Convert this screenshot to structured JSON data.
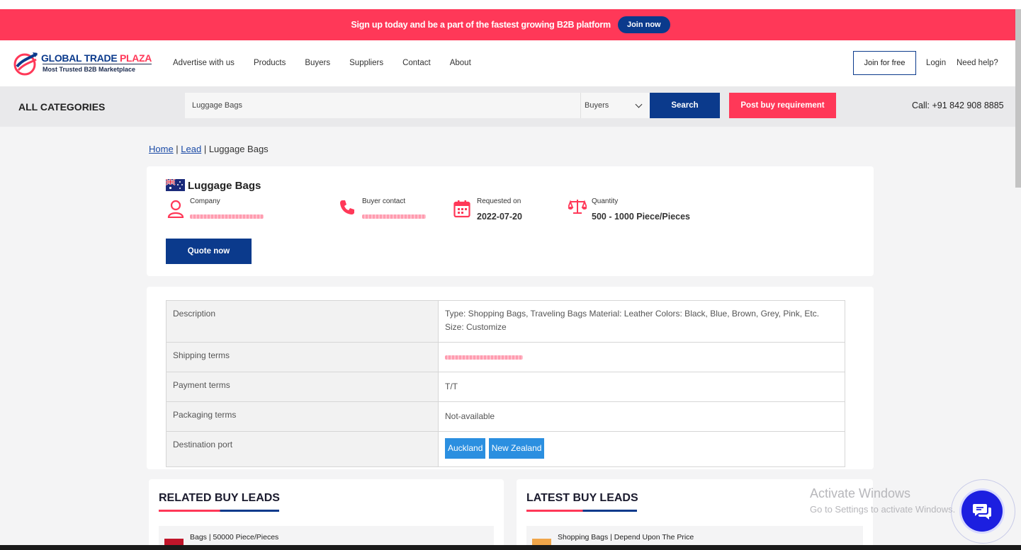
{
  "promo": {
    "text": "Sign up today and be a part of the fastest growing B2B platform",
    "button": "Join now"
  },
  "logo": {
    "title_a": "GLOBAL TRADE ",
    "title_b": "PLAZA",
    "subtitle": "Most Trusted B2B Marketplace"
  },
  "nav": {
    "items": [
      "Advertise with us",
      "Products",
      "Buyers",
      "Suppliers",
      "Contact",
      "About"
    ]
  },
  "header_right": {
    "join": "Join for free",
    "login": "Login",
    "help": "Need help?"
  },
  "search": {
    "all_categories": "ALL CATEGORIES",
    "value": "Luggage Bags",
    "select": "Buyers",
    "button": "Search",
    "post": "Post buy requirement",
    "call": "Call: +91 842 908 8885"
  },
  "breadcrumb": {
    "home": "Home",
    "sep": " | ",
    "lead": "Lead",
    "current": "Luggage Bags"
  },
  "lead": {
    "title": "Luggage Bags",
    "company_label": "Company",
    "buyer_label": "Buyer contact",
    "requested_label": "Requested on",
    "requested_value": "2022-07-20",
    "quantity_label": "Quantity",
    "quantity_value": "500 - 1000 Piece/Pieces",
    "quote_button": "Quote now"
  },
  "details": {
    "description_label": "Description",
    "description_line1": "Type: Shopping Bags, Traveling Bags Material: Leather Colors: Black, Blue, Brown, Grey, Pink, Etc.",
    "description_line2": "Size: Customize",
    "shipping_label": "Shipping terms",
    "payment_label": "Payment terms",
    "payment_value": "T/T",
    "packaging_label": "Packaging terms",
    "packaging_value": "Not-available",
    "destination_label": "Destination port",
    "destination_tags": [
      "Auckland",
      "New Zealand"
    ]
  },
  "related": {
    "title": "RELATED BUY LEADS",
    "first_item": "Bags | 50000 Piece/Pieces"
  },
  "latest": {
    "title": "LATEST BUY LEADS",
    "first_item": "Shopping Bags | Depend Upon The Price"
  },
  "watermark": {
    "line1": "Activate Windows",
    "line2": "Go to Settings to activate Windows."
  },
  "colors": {
    "brand_blue": "#0b3a8c",
    "brand_pink": "#ff3858",
    "tag_blue": "#2b8fe0"
  },
  "icons": {
    "company": "user-icon",
    "buyer": "phone-icon",
    "requested": "calendar-icon",
    "quantity": "scale-icon",
    "chat": "chat-icon"
  }
}
